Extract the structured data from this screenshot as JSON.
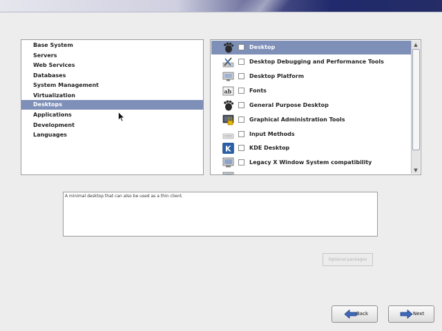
{
  "groups": {
    "items": [
      {
        "label": "Base System"
      },
      {
        "label": "Servers"
      },
      {
        "label": "Web Services"
      },
      {
        "label": "Databases"
      },
      {
        "label": "System Management"
      },
      {
        "label": "Virtualization"
      },
      {
        "label": "Desktops",
        "selected": true
      },
      {
        "label": "Applications"
      },
      {
        "label": "Development"
      },
      {
        "label": "Languages"
      }
    ]
  },
  "packages": {
    "items": [
      {
        "label": "Desktop",
        "icon": "gnome-foot-icon",
        "checked": false,
        "selected": true
      },
      {
        "label": "Desktop Debugging and Performance Tools",
        "icon": "debug-tools-icon",
        "checked": false
      },
      {
        "label": "Desktop Platform",
        "icon": "desktop-platform-icon",
        "checked": false
      },
      {
        "label": "Fonts",
        "icon": "fonts-icon",
        "checked": false
      },
      {
        "label": "General Purpose Desktop",
        "icon": "gnome-foot-icon",
        "checked": false
      },
      {
        "label": "Graphical Administration Tools",
        "icon": "admin-lock-icon",
        "checked": false
      },
      {
        "label": "Input Methods",
        "icon": "keyboard-icon",
        "checked": false
      },
      {
        "label": "KDE Desktop",
        "icon": "kde-icon",
        "checked": false
      },
      {
        "label": "Legacy X Window System compatibility",
        "icon": "monitor-icon",
        "checked": false
      }
    ]
  },
  "description": {
    "text": "A minimal desktop that can also be used as a thin client."
  },
  "buttons": {
    "optional_packages": "Optional packages",
    "back": "Back",
    "next": "Next"
  },
  "colors": {
    "selection": "#7e8fb8",
    "header_dark": "#202a6c"
  }
}
